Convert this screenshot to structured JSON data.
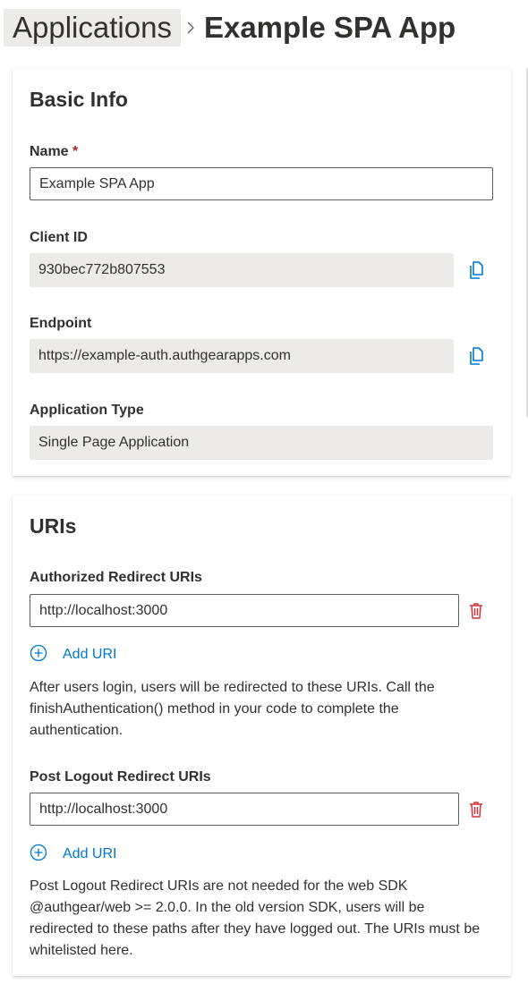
{
  "breadcrumb": {
    "parent": "Applications",
    "current": "Example SPA App"
  },
  "basic_info": {
    "title": "Basic Info",
    "name_label": "Name",
    "name_required_mark": "*",
    "name_value": "Example SPA App",
    "client_id_label": "Client ID",
    "client_id_value": "930bec772b807553",
    "endpoint_label": "Endpoint",
    "endpoint_value": "https://example-auth.authgearapps.com",
    "app_type_label": "Application Type",
    "app_type_value": "Single Page Application"
  },
  "uris": {
    "title": "URIs",
    "redirect_label": "Authorized Redirect URIs",
    "redirect_uris": [
      "http://localhost:3000"
    ],
    "redirect_add_label": "Add URI",
    "redirect_help": "After users login, users will be redirected to these URIs. Call the finishAuthentication() method in your code to complete the authentication.",
    "logout_label": "Post Logout Redirect URIs",
    "logout_uris": [
      "http://localhost:3000"
    ],
    "logout_add_label": "Add URI",
    "logout_help": "Post Logout Redirect URIs are not needed for the web SDK @authgear/web >= 2.0.0. In the old version SDK, users will be redirected to these paths after they have logged out. The URIs must be whitelisted here."
  },
  "icons": {
    "copy": "copy-icon",
    "delete": "trash-icon",
    "add": "add-circle-icon",
    "separator": "chevron-right-icon"
  },
  "colors": {
    "accent": "#0078d4",
    "danger": "#d13438",
    "readonly_bg": "#edebe9",
    "breadcrumb_hover_bg": "#edebe9"
  }
}
